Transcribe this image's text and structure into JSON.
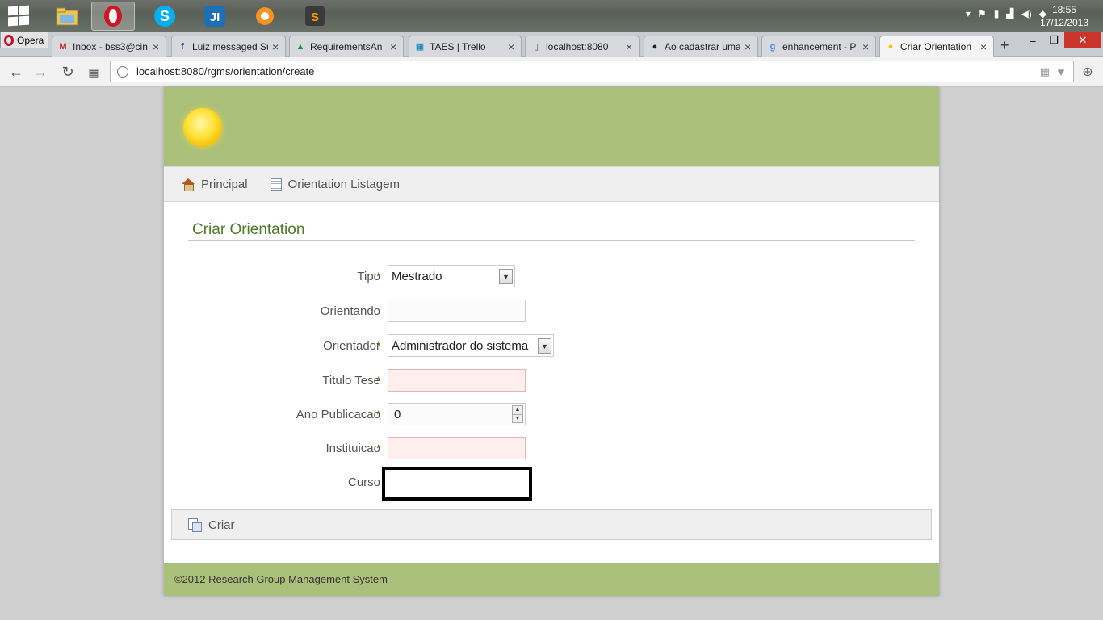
{
  "taskbar": {
    "apps": [
      {
        "name": "file-explorer",
        "glyph": "▤"
      },
      {
        "name": "opera",
        "glyph": "O"
      },
      {
        "name": "skype",
        "glyph": "S"
      },
      {
        "name": "intellij",
        "glyph": "JI"
      },
      {
        "name": "avast",
        "glyph": "✸"
      },
      {
        "name": "sublime-text",
        "glyph": "S"
      }
    ],
    "clock_time": "18:55",
    "clock_date": "17/12/2013"
  },
  "browser": {
    "menu_label": "Opera",
    "tabs": [
      {
        "title": "Inbox - bss3@cin",
        "favicon": "M",
        "color": "#c62828"
      },
      {
        "title": "Luiz messaged Su",
        "favicon": "f",
        "color": "#3b5998"
      },
      {
        "title": "RequirementsAn",
        "favicon": "▲",
        "color": "#1e8e3e"
      },
      {
        "title": "TAES | Trello",
        "favicon": "▦",
        "color": "#0079bf"
      },
      {
        "title": "localhost:8080",
        "favicon": "▯",
        "color": "#555555"
      },
      {
        "title": "Ao cadastrar uma",
        "favicon": "●",
        "color": "#222222"
      },
      {
        "title": "enhancement - P",
        "favicon": "g",
        "color": "#4285f4"
      },
      {
        "title": "Criar Orientation",
        "favicon": "●",
        "color": "#f2c200"
      }
    ],
    "url": "localhost:8080/rgms/orientation/create"
  },
  "page": {
    "nav": {
      "home_label": "Principal",
      "list_label": "Orientation Listagem"
    },
    "title": "Criar Orientation",
    "form": {
      "tipo_label": "Tipo",
      "tipo_value": "Mestrado",
      "orientando_label": "Orientando",
      "orientando_value": "",
      "orientador_label": "Orientador",
      "orientador_value": "Administrador do sistema",
      "titulo_tese_label": "Titulo Tese",
      "titulo_tese_value": "",
      "ano_publicacao_label": "Ano Publicacao",
      "ano_publicacao_value": "0",
      "instituicao_label": "Instituicao",
      "instituicao_value": "",
      "curso_label": "Curso",
      "curso_value": "",
      "required_mark": "*"
    },
    "create_label": "Criar",
    "footer": "©2012 Research Group Management System"
  }
}
